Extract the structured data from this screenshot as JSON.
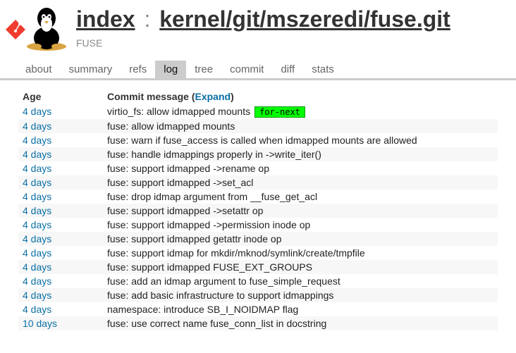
{
  "header": {
    "index_label": "index",
    "colon": ":",
    "repo": "kernel/git/mszeredi/fuse.git",
    "subtitle": "FUSE"
  },
  "tabs": [
    {
      "label": "about",
      "active": false
    },
    {
      "label": "summary",
      "active": false
    },
    {
      "label": "refs",
      "active": false
    },
    {
      "label": "log",
      "active": true
    },
    {
      "label": "tree",
      "active": false
    },
    {
      "label": "commit",
      "active": false
    },
    {
      "label": "diff",
      "active": false
    },
    {
      "label": "stats",
      "active": false
    }
  ],
  "columns": {
    "age": "Age",
    "commit_prefix": "Commit message (",
    "expand": "Expand",
    "commit_suffix": ")",
    "branch_tag": "for-next"
  },
  "commits": [
    {
      "age": "4 days",
      "msg": "virtio_fs: allow idmapped mounts",
      "tag": true
    },
    {
      "age": "4 days",
      "msg": "fuse: allow idmapped mounts"
    },
    {
      "age": "4 days",
      "msg": "fuse: warn if fuse_access is called when idmapped mounts are allowed"
    },
    {
      "age": "4 days",
      "msg": "fuse: handle idmappings properly in ->write_iter()"
    },
    {
      "age": "4 days",
      "msg": "fuse: support idmapped ->rename op"
    },
    {
      "age": "4 days",
      "msg": "fuse: support idmapped ->set_acl"
    },
    {
      "age": "4 days",
      "msg": "fuse: drop idmap argument from __fuse_get_acl"
    },
    {
      "age": "4 days",
      "msg": "fuse: support idmapped ->setattr op"
    },
    {
      "age": "4 days",
      "msg": "fuse: support idmapped ->permission inode op"
    },
    {
      "age": "4 days",
      "msg": "fuse: support idmapped getattr inode op"
    },
    {
      "age": "4 days",
      "msg": "fuse: support idmap for mkdir/mknod/symlink/create/tmpfile"
    },
    {
      "age": "4 days",
      "msg": "fuse: support idmapped FUSE_EXT_GROUPS"
    },
    {
      "age": "4 days",
      "msg": "fuse: add an idmap argument to fuse_simple_request"
    },
    {
      "age": "4 days",
      "msg": "fuse: add basic infrastructure to support idmappings"
    },
    {
      "age": "4 days",
      "msg": "namespace: introduce SB_I_NOIDMAP flag"
    },
    {
      "age": "10 days",
      "msg": "fuse: use correct name fuse_conn_list in docstring"
    }
  ]
}
